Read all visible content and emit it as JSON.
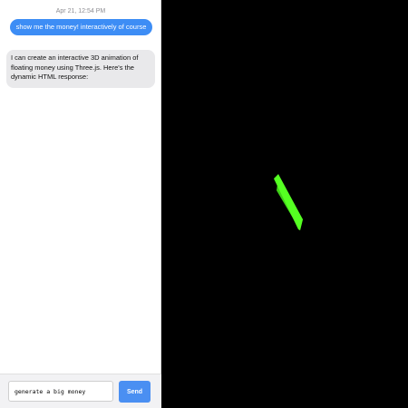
{
  "chat": {
    "timestamp": "Apr 21, 12:54 PM",
    "messages": [
      {
        "role": "user",
        "text": "show me the money! interactively of course"
      },
      {
        "role": "assistant",
        "text": "I can create an interactive 3D animation of floating money using Three.js. Here's the dynamic HTML response:"
      }
    ]
  },
  "composer": {
    "input_value": "generate a big money",
    "send_label": "Send"
  },
  "scene": {
    "background_color": "#000000",
    "bill_color": "#55ff22",
    "bill_edge_color": "#3fd018"
  }
}
